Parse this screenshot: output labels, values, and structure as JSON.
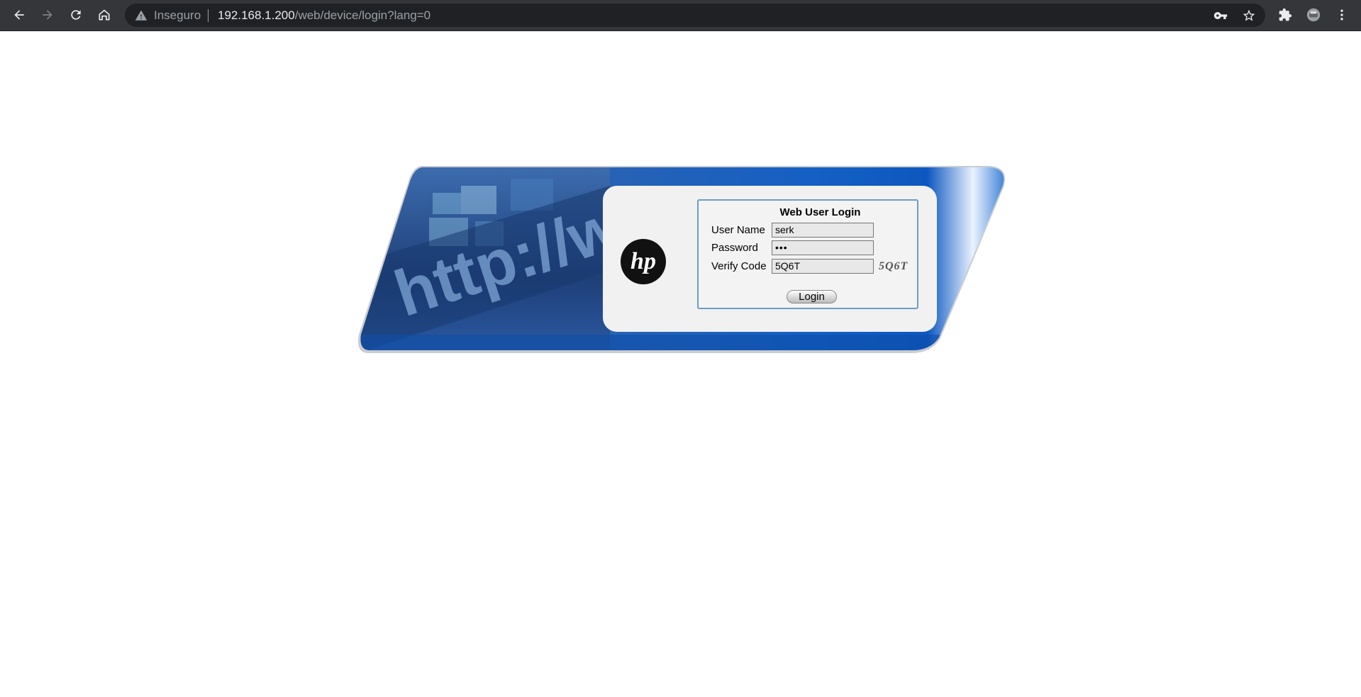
{
  "browser": {
    "security_label": "Inseguro",
    "url_host": "192.168.1.200",
    "url_path": "/web/device/login?lang=0",
    "icons": [
      "back-icon",
      "forward-icon",
      "reload-icon",
      "home-icon",
      "warning-icon",
      "key-icon",
      "star-icon",
      "extensions-icon",
      "profile-avatar",
      "menu-icon"
    ]
  },
  "banner": {
    "background_text": "http://ww",
    "logo_text": "hp"
  },
  "login": {
    "title": "Web User Login",
    "username_label": "User Name",
    "username_value": "serk",
    "password_label": "Password",
    "password_value": "•••",
    "verify_label": "Verify Code",
    "verify_value": "5Q6T",
    "captcha_text": "5Q6T",
    "button_label": "Login"
  },
  "colors": {
    "chrome_bg": "#35363a",
    "omnibox_bg": "#202124",
    "banner_blue": "#1565c0",
    "form_border": "#6a9ec4"
  }
}
